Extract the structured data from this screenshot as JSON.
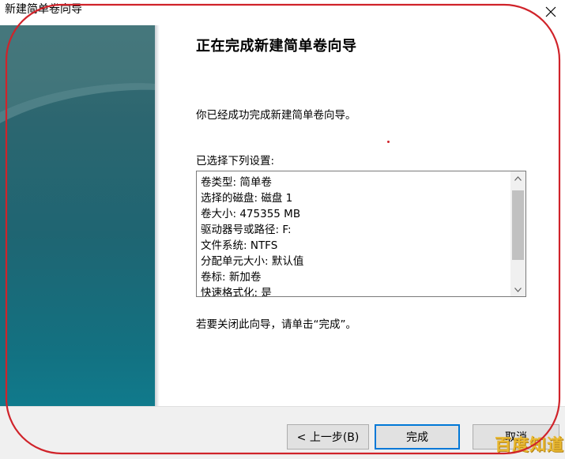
{
  "window": {
    "title": "新建简单卷向导",
    "close_icon": "close-icon"
  },
  "main": {
    "heading": "正在完成新建简单卷向导",
    "description": "你已经成功完成新建简单卷向导。",
    "settings_label": "已选择下列设置:",
    "settings": [
      "卷类型: 简单卷",
      "选择的磁盘: 磁盘 1",
      "卷大小: 475355 MB",
      "驱动器号或路径: F:",
      "文件系统: NTFS",
      "分配单元大小: 默认值",
      "卷标: 新加卷",
      "快速格式化: 是"
    ],
    "close_hint": "若要关闭此向导，请单击“完成”。"
  },
  "buttons": {
    "back": "< 上一步(B)",
    "finish": "完成",
    "cancel": "取消"
  },
  "watermark": "百度知道",
  "colors": {
    "panel": "#1f6572",
    "annotation": "#d0232a",
    "focus": "#0078d7",
    "watermark": "#e8b830"
  }
}
